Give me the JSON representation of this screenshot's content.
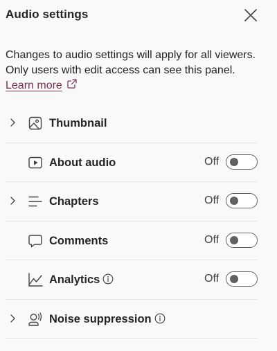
{
  "panel": {
    "title": "Audio settings",
    "description": "Changes to audio settings will apply for all viewers. Only users with edit access can see this panel.",
    "learn_more": "Learn more"
  },
  "rows": [
    {
      "label": "Thumbnail",
      "expandable": true,
      "icon": "image-icon",
      "has_toggle": false
    },
    {
      "label": "About audio",
      "expandable": false,
      "icon": "play-icon",
      "has_toggle": true,
      "state": "Off"
    },
    {
      "label": "Chapters",
      "expandable": true,
      "icon": "list-icon",
      "has_toggle": true,
      "state": "Off"
    },
    {
      "label": "Comments",
      "expandable": false,
      "icon": "comment-icon",
      "has_toggle": true,
      "state": "Off"
    },
    {
      "label": "Analytics",
      "expandable": false,
      "icon": "chart-icon",
      "has_toggle": true,
      "state": "Off",
      "info": true
    },
    {
      "label": "Noise suppression",
      "expandable": true,
      "icon": "person-voice-icon",
      "has_toggle": false,
      "info": true
    }
  ],
  "colors": {
    "link": "#7a2f4f",
    "background": "#f9f9f9",
    "divider": "#e5e5e5"
  }
}
